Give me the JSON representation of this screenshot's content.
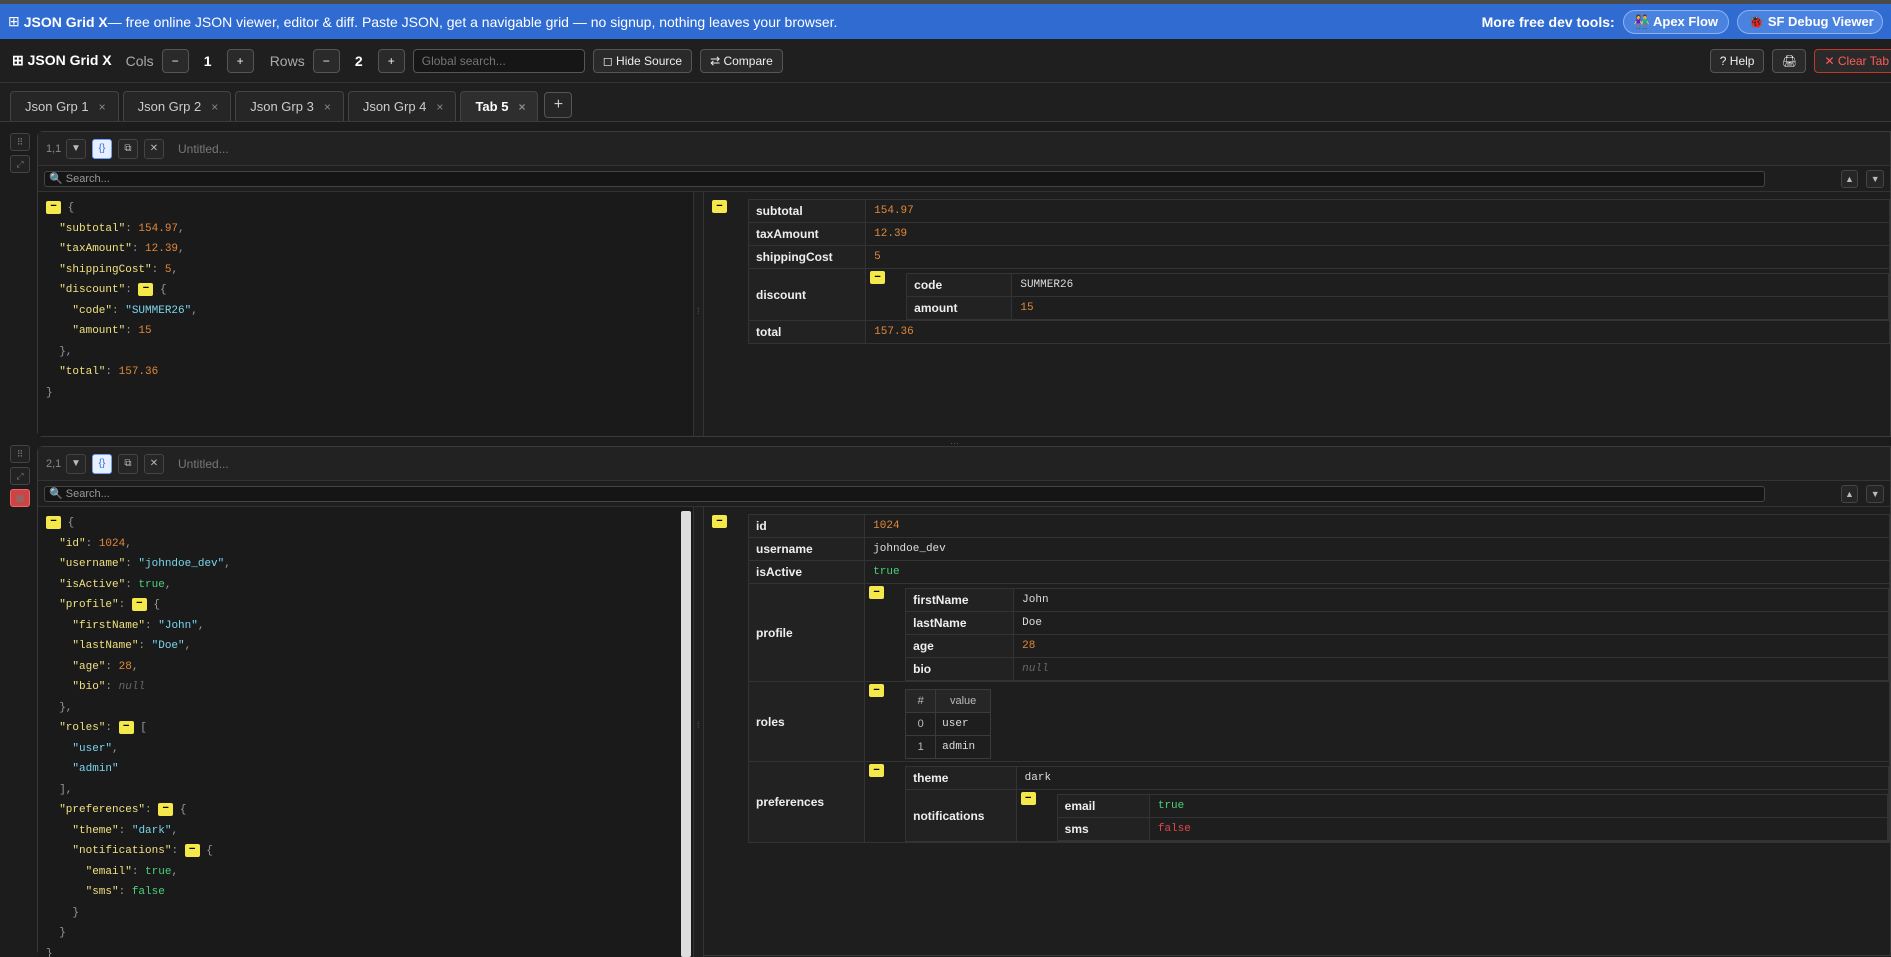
{
  "banner": {
    "icon": "⊞",
    "brand": "JSON Grid X",
    "tagline": " — free online JSON viewer, editor & diff. Paste JSON, get a navigable grid — no signup, nothing leaves your browser.",
    "more_label": "More free dev tools:",
    "apex_label": "Apex Flow",
    "sfdebug_label": "SF Debug Viewer"
  },
  "toolbar": {
    "app_title": "⊞ JSON Grid X",
    "cols_label": "Cols",
    "cols_value": "1",
    "rows_label": "Rows",
    "rows_value": "2",
    "minus": "−",
    "plus": "+",
    "search_placeholder": "Global search...",
    "hide_source_label": "◻ Hide Source",
    "compare_label": "⇄ Compare",
    "help_label": "? Help",
    "print_label": "🖨",
    "clear_label": "✕ Clear Tab"
  },
  "tabs": [
    {
      "label": "Json Grp 1"
    },
    {
      "label": "Json Grp 2"
    },
    {
      "label": "Json Grp 3"
    },
    {
      "label": "Json Grp 4"
    },
    {
      "label": "Tab 5",
      "active": true
    }
  ],
  "tab_close": "×",
  "add_tab": "+",
  "panels": [
    {
      "position": "1,1",
      "title": "Untitled...",
      "search_placeholder": "🔍 Search...",
      "grid": {
        "subtotal": "154.97",
        "taxAmount": "12.39",
        "shippingCost": "5",
        "discount": {
          "code": "SUMMER26",
          "amount": "15"
        },
        "total": "157.36"
      }
    },
    {
      "position": "2,1",
      "title": "Untitled...",
      "search_placeholder": "🔍 Search...",
      "grid": {
        "id": "1024",
        "username": "johndoe_dev",
        "isActive": "true",
        "profile": {
          "firstName": "John",
          "lastName": "Doe",
          "age": "28",
          "bio": "null"
        },
        "roles": {
          "header_index": "#",
          "header_value": "value",
          "items": [
            {
              "i": "0",
              "v": "user"
            },
            {
              "i": "1",
              "v": "admin"
            }
          ]
        },
        "preferences": {
          "theme": "dark",
          "notifications": {
            "email": "true",
            "sms": "false"
          }
        }
      }
    }
  ],
  "colors": {
    "banner_bg": "#2f6bd0",
    "key": "#f0e080",
    "string": "#7ad5ee",
    "number": "#e0883a",
    "boolean_true": "#4ad07a",
    "boolean_false": "#e04848",
    "fold_badge": "#f4e84a"
  },
  "fold_glyph": "−"
}
